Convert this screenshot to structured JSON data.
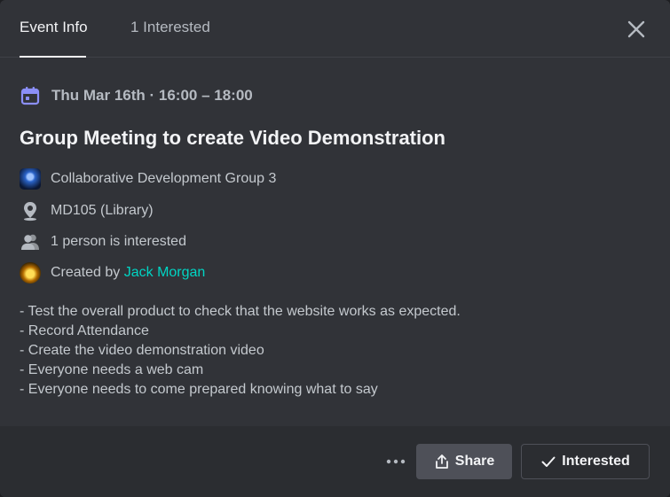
{
  "tabs": [
    {
      "label": "Event Info",
      "active": true
    },
    {
      "label": "1 Interested",
      "active": false
    }
  ],
  "event": {
    "date_time": "Thu Mar 16th · 16:00 – 18:00",
    "title": "Group Meeting to create Video Demonstration",
    "server": "Collaborative Development Group 3",
    "location": "MD105 (Library)",
    "interested_count": "1 person is interested",
    "created_by_prefix": "Created by ",
    "creator": "Jack Morgan",
    "description": [
      "- Test the overall product to check that the website works as expected.",
      "- Record Attendance",
      "- Create the video demonstration video",
      "- Everyone needs a web cam",
      "- Everyone needs to come prepared knowing what to say"
    ]
  },
  "footer": {
    "share_label": "Share",
    "interested_label": "Interested"
  },
  "colors": {
    "accent_icon": "#8b8ff7",
    "creator_link": "#00d5c4",
    "background": "#313338",
    "footer_background": "#2b2d31"
  },
  "icons": {
    "date": "calendar-icon",
    "server": "server-icon",
    "location": "location-pin-icon",
    "interested": "people-icon",
    "creator": "avatar",
    "close": "close-icon",
    "more": "more-dots-icon",
    "share": "share-icon",
    "interested_button": "checkmark-icon"
  }
}
